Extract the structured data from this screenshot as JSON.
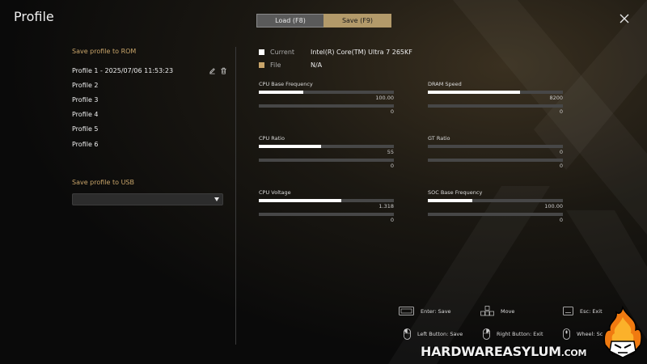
{
  "page": {
    "title": "Profile"
  },
  "tabs": [
    {
      "label": "Load (F8)",
      "active": false
    },
    {
      "label": "Save (F9)",
      "active": true
    }
  ],
  "rom": {
    "heading": "Save profile to ROM",
    "profiles": [
      {
        "label": "Profile 1 - 2025/07/06 11:53:23",
        "has_actions": true
      },
      {
        "label": "Profile 2"
      },
      {
        "label": "Profile 3"
      },
      {
        "label": "Profile 4"
      },
      {
        "label": "Profile 5"
      },
      {
        "label": "Profile 6"
      }
    ]
  },
  "usb": {
    "heading": "Save profile to USB",
    "selected": ""
  },
  "legend": {
    "current": {
      "label": "Current",
      "value": "Intel(R) Core(TM) Ultra 7 265KF",
      "color": "#ffffff"
    },
    "file": {
      "label": "File",
      "value": "N/A",
      "color": "#c9a56a"
    }
  },
  "metrics": [
    {
      "label": "CPU Base Frequency",
      "current": "100.00",
      "current_fill": 0.33,
      "file": "0",
      "file_fill": 0
    },
    {
      "label": "DRAM Speed",
      "current": "8200",
      "current_fill": 0.68,
      "file": "0",
      "file_fill": 0
    },
    {
      "label": "CPU Ratio",
      "current": "55",
      "current_fill": 0.46,
      "file": "0",
      "file_fill": 0
    },
    {
      "label": "GT Ratio",
      "current": "0",
      "current_fill": 0,
      "file": "0",
      "file_fill": 0
    },
    {
      "label": "CPU Voltage",
      "current": "1.318",
      "current_fill": 0.61,
      "file": "0",
      "file_fill": 0
    },
    {
      "label": "SOC Base Frequency",
      "current": "100.00",
      "current_fill": 0.33,
      "file": "0",
      "file_fill": 0
    }
  ],
  "hints": {
    "enter": "Enter: Save",
    "move": "Move",
    "esc": "Esc: Exit",
    "left_button": "Left Button: Save",
    "right_button": "Right Button: Exit",
    "wheel": "Wheel: Sc"
  },
  "watermark": {
    "brand": "HARDWAREASYLUM",
    "domain": ".COM"
  },
  "colors": {
    "accent": "#c9a56a",
    "tab_active": "#b39a6a",
    "tab_inactive": "#5a5a5a"
  }
}
